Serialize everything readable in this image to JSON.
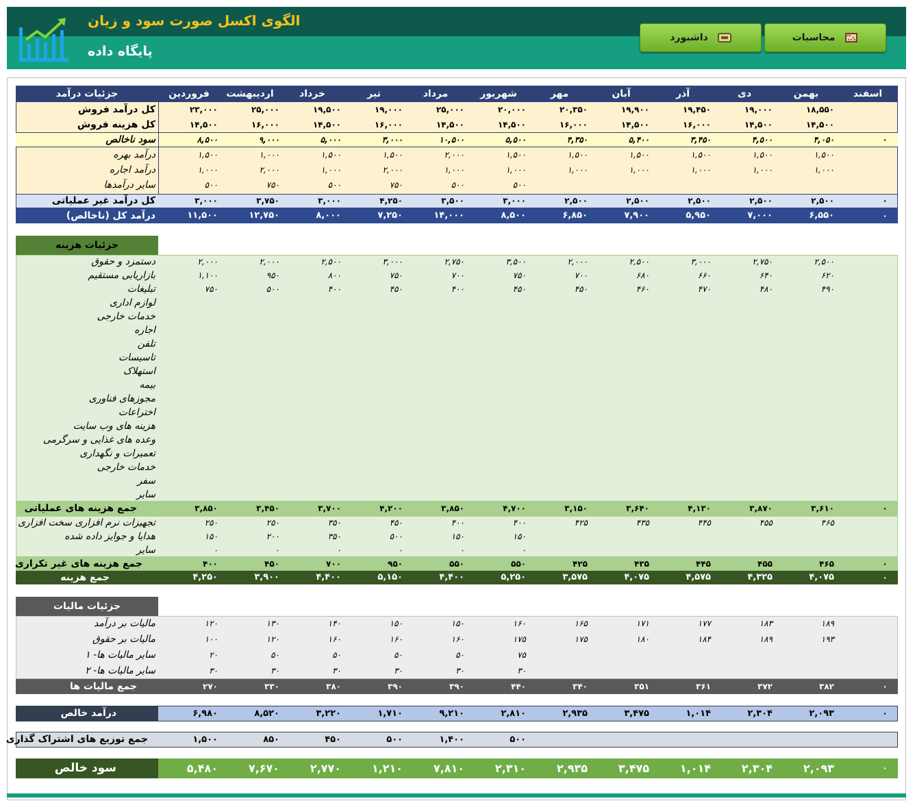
{
  "header": {
    "title": "الگوی اکسل صورت سود و زیان",
    "subtitle": "پایگاه داده",
    "btn_calc": "محاسبات",
    "btn_dash": "داشبورد",
    "logo_icon": "bar-chart-trend-icon",
    "calc_icon": "abacus-icon",
    "dash_icon": "ticket-icon",
    "colors": {
      "dark": "#0d5a4d",
      "teal": "#159f80",
      "gold": "#f6c21b",
      "green_btn": "#8fcf4b"
    }
  },
  "months": [
    "فروردین",
    "اردیبهشت",
    "خرداد",
    "تیر",
    "مرداد",
    "شهریور",
    "مهر",
    "آبان",
    "آذر",
    "دی",
    "بهمن",
    "اسفند"
  ],
  "revenue": {
    "header_label": "جزئیات درآمد",
    "rows": [
      {
        "label": "کل درآمد فروش",
        "values": [
          "۲۳,۰۰۰",
          "۲۵,۰۰۰",
          "۱۹,۵۰۰",
          "۱۹,۰۰۰",
          "۲۵,۰۰۰",
          "۲۰,۰۰۰",
          "۲۰,۳۵۰",
          "۱۹,۹۰۰",
          "۱۹,۴۵۰",
          "۱۹,۰۰۰",
          "۱۸,۵۵۰",
          ""
        ],
        "zero": ""
      },
      {
        "label": "کل هزینه فروش",
        "values": [
          "۱۴,۵۰۰",
          "۱۶,۰۰۰",
          "۱۴,۵۰۰",
          "۱۶,۰۰۰",
          "۱۴,۵۰۰",
          "۱۴,۵۰۰",
          "۱۶,۰۰۰",
          "۱۴,۵۰۰",
          "۱۶,۰۰۰",
          "۱۴,۵۰۰",
          "۱۴,۵۰۰",
          ""
        ],
        "zero": ""
      },
      {
        "label": "سود ناخالص",
        "values": [
          "۸,۵۰۰",
          "۹,۰۰۰",
          "۵,۰۰۰",
          "۳,۰۰۰",
          "۱۰,۵۰۰",
          "۵,۵۰۰",
          "۴,۳۵۰",
          "۵,۴۰۰",
          "۳,۴۵۰",
          "۴,۵۰۰",
          "۴,۰۵۰",
          ""
        ],
        "zero": "۰"
      },
      {
        "label": "درآمد بهره",
        "values": [
          "۱,۵۰۰",
          "۱,۰۰۰",
          "۱,۵۰۰",
          "۱,۵۰۰",
          "۲,۰۰۰",
          "۱,۵۰۰",
          "۱,۵۰۰",
          "۱,۵۰۰",
          "۱,۵۰۰",
          "۱,۵۰۰",
          "۱,۵۰۰",
          ""
        ],
        "zero": ""
      },
      {
        "label": "درآمد اجاره",
        "values": [
          "۱,۰۰۰",
          "۲,۰۰۰",
          "۱,۰۰۰",
          "۲,۰۰۰",
          "۱,۰۰۰",
          "۱,۰۰۰",
          "۱,۰۰۰",
          "۱,۰۰۰",
          "۱,۰۰۰",
          "۱,۰۰۰",
          "۱,۰۰۰",
          ""
        ],
        "zero": ""
      },
      {
        "label": "سایر درآمدها",
        "values": [
          "۵۰۰",
          "۷۵۰",
          "۵۰۰",
          "۷۵۰",
          "۵۰۰",
          "۵۰۰",
          "",
          "",
          "",
          "",
          "",
          ""
        ],
        "zero": ""
      },
      {
        "label": "کل درآمد غیر عملیاتی",
        "values": [
          "۳,۰۰۰",
          "۳,۷۵۰",
          "۳,۰۰۰",
          "۴,۲۵۰",
          "۳,۵۰۰",
          "۳,۰۰۰",
          "۲,۵۰۰",
          "۲,۵۰۰",
          "۲,۵۰۰",
          "۲,۵۰۰",
          "۲,۵۰۰",
          ""
        ],
        "zero": "۰"
      },
      {
        "label": "درآمد کل (ناخالص)",
        "values": [
          "۱۱,۵۰۰",
          "۱۲,۷۵۰",
          "۸,۰۰۰",
          "۷,۲۵۰",
          "۱۴,۰۰۰",
          "۸,۵۰۰",
          "۶,۸۵۰",
          "۷,۹۰۰",
          "۵,۹۵۰",
          "۷,۰۰۰",
          "۶,۵۵۰",
          ""
        ],
        "zero": "۰"
      }
    ]
  },
  "expenses": {
    "header_label": "جزئیات هزینه",
    "rows": [
      {
        "label": "دستمزد و حقوق",
        "values": [
          "۲,۰۰۰",
          "۲,۰۰۰",
          "۲,۵۰۰",
          "۳,۰۰۰",
          "۲,۷۵۰",
          "۳,۵۰۰",
          "۲,۰۰۰",
          "۲,۵۰۰",
          "۳,۰۰۰",
          "۲,۷۵۰",
          "۲,۵۰۰",
          ""
        ]
      },
      {
        "label": "بازاریابی مستقیم",
        "values": [
          "۱,۱۰۰",
          "۹۵۰",
          "۸۰۰",
          "۷۵۰",
          "۷۰۰",
          "۷۵۰",
          "۷۰۰",
          "۶۸۰",
          "۶۶۰",
          "۶۴۰",
          "۶۲۰",
          ""
        ]
      },
      {
        "label": "تبلیغات",
        "values": [
          "۷۵۰",
          "۵۰۰",
          "۴۰۰",
          "۴۵۰",
          "۴۰۰",
          "۴۵۰",
          "۴۵۰",
          "۴۶۰",
          "۴۷۰",
          "۴۸۰",
          "۴۹۰",
          ""
        ]
      },
      {
        "label": "لوازم اداری",
        "values": []
      },
      {
        "label": "خدمات خارجی",
        "values": []
      },
      {
        "label": "اجاره",
        "values": []
      },
      {
        "label": "تلفن",
        "values": []
      },
      {
        "label": "تاسیسات",
        "values": []
      },
      {
        "label": "استهلاک",
        "values": []
      },
      {
        "label": "بیمه",
        "values": []
      },
      {
        "label": "مجوزهای فناوری",
        "values": []
      },
      {
        "label": "اختراعات",
        "values": []
      },
      {
        "label": "هزینه های وب سایت",
        "values": []
      },
      {
        "label": "وعده های غذایی و سرگرمی",
        "values": []
      },
      {
        "label": "تعمیرات و نگهداری",
        "values": []
      },
      {
        "label": "خدمات خارجی",
        "values": []
      },
      {
        "label": "سفر",
        "values": []
      },
      {
        "label": "سایر",
        "values": []
      }
    ],
    "operating_total": {
      "label": "جمع هزینه های عملیاتی",
      "values": [
        "۳,۸۵۰",
        "۳,۴۵۰",
        "۳,۷۰۰",
        "۴,۲۰۰",
        "۳,۸۵۰",
        "۴,۷۰۰",
        "۳,۱۵۰",
        "۳,۶۴۰",
        "۴,۱۳۰",
        "۳,۸۷۰",
        "۳,۶۱۰",
        ""
      ],
      "zero": "۰"
    },
    "nonrecurring": [
      {
        "label": "تجهیزات نرم افزاری سخت افزاری",
        "values": [
          "۲۵۰",
          "۲۵۰",
          "۳۵۰",
          "۴۵۰",
          "۴۰۰",
          "۴۰۰",
          "۴۲۵",
          "۴۳۵",
          "۴۴۵",
          "۴۵۵",
          "۴۶۵",
          ""
        ]
      },
      {
        "label": "هدایا و جوایز داده شده",
        "values": [
          "۱۵۰",
          "۲۰۰",
          "۳۵۰",
          "۵۰۰",
          "۱۵۰",
          "۱۵۰",
          "",
          "",
          "",
          "",
          "",
          ""
        ]
      },
      {
        "label": "سایر",
        "values": [
          "۰",
          "۰",
          "۰",
          "۰",
          "۰",
          "۰",
          "",
          "",
          "",
          "",
          "",
          ""
        ]
      }
    ],
    "nonrecurring_total": {
      "label": "جمع هزینه های غیر تکراری",
      "values": [
        "۴۰۰",
        "۴۵۰",
        "۷۰۰",
        "۹۵۰",
        "۵۵۰",
        "۵۵۰",
        "۴۲۵",
        "۴۳۵",
        "۴۴۵",
        "۴۵۵",
        "۴۶۵",
        ""
      ],
      "zero": "۰"
    },
    "grand_total": {
      "label": "جمع هزینه",
      "values": [
        "۴,۲۵۰",
        "۳,۹۰۰",
        "۴,۴۰۰",
        "۵,۱۵۰",
        "۴,۴۰۰",
        "۵,۲۵۰",
        "۳,۵۷۵",
        "۴,۰۷۵",
        "۴,۵۷۵",
        "۴,۳۲۵",
        "۴,۰۷۵",
        ""
      ],
      "zero": "۰"
    }
  },
  "taxes": {
    "header_label": "جزئیات مالیات",
    "rows": [
      {
        "label": "مالیات بر درآمد",
        "values": [
          "۱۲۰",
          "۱۳۰",
          "۱۴۰",
          "۱۵۰",
          "۱۵۰",
          "۱۶۰",
          "۱۶۵",
          "۱۷۱",
          "۱۷۷",
          "۱۸۳",
          "۱۸۹",
          ""
        ]
      },
      {
        "label": "مالیات بر حقوق",
        "values": [
          "۱۰۰",
          "۱۲۰",
          "۱۶۰",
          "۱۶۰",
          "۱۶۰",
          "۱۷۵",
          "۱۷۵",
          "۱۸۰",
          "۱۸۴",
          "۱۸۹",
          "۱۹۳",
          ""
        ]
      },
      {
        "label": "سایر مالیات ها- ۱",
        "values": [
          "۲۰",
          "۵۰",
          "۵۰",
          "۵۰",
          "۵۰",
          "۷۵",
          "",
          "",
          "",
          "",
          "",
          ""
        ]
      },
      {
        "label": "سایر مالیات ها- ۲",
        "values": [
          "۳۰",
          "۳۰",
          "۳۰",
          "۳۰",
          "۳۰",
          "۳۰",
          "",
          "",
          "",
          "",
          "",
          ""
        ]
      }
    ],
    "total": {
      "label": "جمع مالیات ها",
      "values": [
        "۲۷۰",
        "۳۳۰",
        "۳۸۰",
        "۳۹۰",
        "۳۹۰",
        "۴۴۰",
        "۳۴۰",
        "۳۵۱",
        "۳۶۱",
        "۳۷۲",
        "۳۸۲",
        ""
      ],
      "zero": "۰"
    }
  },
  "net_income": {
    "label": "درآمد خالص",
    "values": [
      "۶,۹۸۰",
      "۸,۵۲۰",
      "۳,۲۲۰",
      "۱,۷۱۰",
      "۹,۲۱۰",
      "۲,۸۱۰",
      "۲,۹۳۵",
      "۳,۴۷۵",
      "۱,۰۱۴",
      "۲,۳۰۴",
      "۲,۰۹۳",
      ""
    ],
    "zero": "۰"
  },
  "distributions": {
    "label": "جمع توزیع های اشتراک گذاری",
    "values": [
      "۱,۵۰۰",
      "۸۵۰",
      "۴۵۰",
      "۵۰۰",
      "۱,۴۰۰",
      "۵۰۰",
      "",
      "",
      "",
      "",
      "",
      ""
    ],
    "zero": ""
  },
  "net_profit": {
    "label": "سود خالص",
    "values": [
      "۵,۴۸۰",
      "۷,۶۷۰",
      "۲,۷۷۰",
      "۱,۲۱۰",
      "۷,۸۱۰",
      "۲,۳۱۰",
      "۲,۹۳۵",
      "۳,۴۷۵",
      "۱,۰۱۴",
      "۲,۳۰۴",
      "۲,۰۹۳",
      ""
    ],
    "zero": "۰"
  }
}
